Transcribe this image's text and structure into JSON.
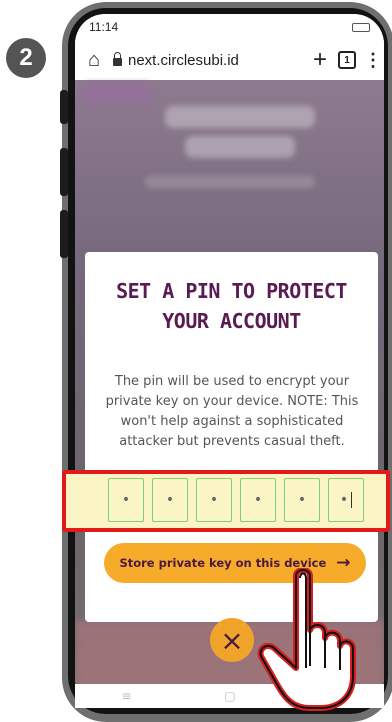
{
  "step": {
    "number": "2"
  },
  "statusbar": {
    "time": "11:14"
  },
  "browser": {
    "url": "next.circlesubi.id",
    "tab_count": "1"
  },
  "modal": {
    "title": "SET A PIN TO PROTECT YOUR ACCOUNT",
    "description": "The pin will be used to encrypt your private key on your device. NOTE: This won't help against a sophisticated attacker but prevents casual theft.",
    "pin_digits": [
      "•",
      "•",
      "•",
      "•",
      "•",
      "•"
    ],
    "store_button": "Store private key on this device",
    "close_label": "×"
  },
  "colors": {
    "title": "#5a1b52",
    "accent": "#f6ab2a",
    "highlight_border": "#e11a1a",
    "pin_fill": "#fbf4c4"
  },
  "icons": [
    "home-icon",
    "lock-icon",
    "plus-icon",
    "tabs-icon",
    "menu-icon",
    "arrow-right-icon",
    "close-icon",
    "hand-pointer-icon"
  ]
}
